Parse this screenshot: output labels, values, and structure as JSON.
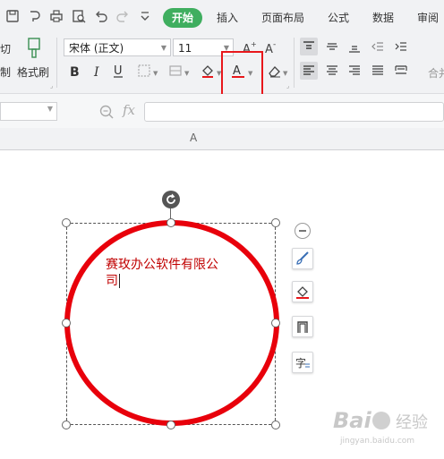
{
  "tabs": {
    "start": "开始",
    "insert": "插入",
    "page_layout": "页面布局",
    "formula": "公式",
    "data": "数据",
    "review": "审阅"
  },
  "ribbon": {
    "cut_fragment": "切",
    "paste_fragment": "制",
    "format_painter": "格式刷",
    "font_name": "宋体 (正文)",
    "font_size": "11",
    "merge_fragment": "合并"
  },
  "sheet": {
    "column_a": "A",
    "formula_fx": "fx"
  },
  "textbox": {
    "line1": "赛玫办公软件有限公",
    "line2": "司"
  },
  "colors": {
    "accent_green": "#3fae5f",
    "circle_red": "#e8000b",
    "highlight_box": "#e8171b",
    "text_dark_red": "#c00000"
  },
  "watermark": {
    "text": "Bai 经验",
    "sub": "jingyan.baidu.com"
  }
}
